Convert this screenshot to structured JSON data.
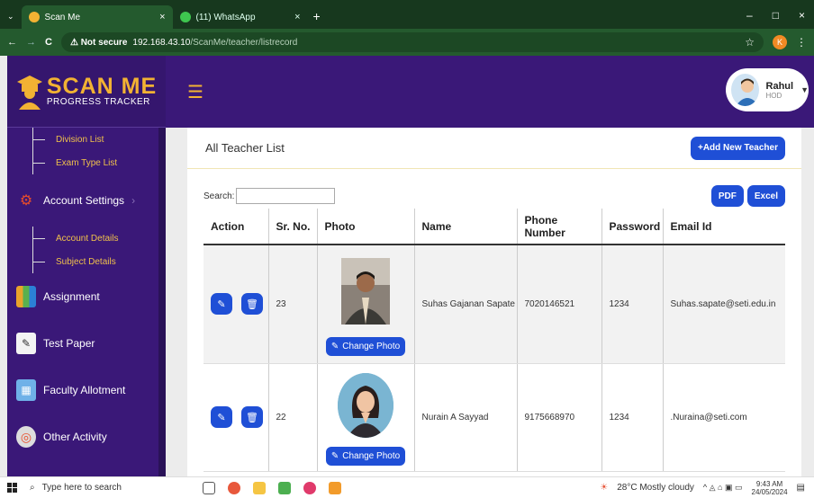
{
  "browser": {
    "tabs": [
      {
        "title": "Scan Me",
        "close": "×"
      },
      {
        "title": "(11) WhatsApp",
        "close": "×"
      }
    ],
    "new_tab": "+",
    "window_controls": {
      "minimize": "–",
      "maximize": "□",
      "close": "×"
    },
    "nav": {
      "back": "←",
      "forward": "→",
      "reload": "C"
    },
    "security": "⚠ Not secure",
    "url_host": "192.168.43.10",
    "url_path": "/ScanMe/teacher/listrecord",
    "star": "☆",
    "profile_initial": "K"
  },
  "logo": {
    "title": "SCAN ME",
    "subtitle": "PROGRESS TRACKER"
  },
  "sidebar": {
    "sub_top": [
      {
        "label": "Division List"
      },
      {
        "label": "Exam Type List"
      }
    ],
    "account": {
      "label": "Account Settings",
      "arrow": "›"
    },
    "sub_account": [
      {
        "label": "Account Details"
      },
      {
        "label": "Subject Details"
      }
    ],
    "items": [
      {
        "label": "Assignment"
      },
      {
        "label": "Test Paper"
      },
      {
        "label": "Faculty Allotment"
      },
      {
        "label": "Other Activity"
      }
    ]
  },
  "header": {
    "menu_icon": "☰",
    "user_name": "Rahul",
    "user_role": "HOD",
    "caret": "▼"
  },
  "page": {
    "title": "All Teacher List",
    "add_button": "+Add New Teacher",
    "search_label": "Search:",
    "search_value": "",
    "pdf_button": "PDF",
    "excel_button": "Excel",
    "change_photo": "Change Photo"
  },
  "table": {
    "columns": [
      "Action",
      "Sr. No.",
      "Photo",
      "Name",
      "Phone Number",
      "Password",
      "Email Id"
    ],
    "rows": [
      {
        "sr": "23",
        "name": "Suhas Gajanan Sapate",
        "phone": "7020146521",
        "password": "1234",
        "email": "Suhas.sapate@seti.edu.in"
      },
      {
        "sr": "22",
        "name": "Nurain A Sayyad",
        "phone": "9175668970",
        "password": "1234",
        "email": ".Nuraina@seti.com"
      }
    ]
  },
  "taskbar": {
    "search_placeholder": "Type here to search",
    "weather": "28°C  Mostly cloudy",
    "time": "9:43 AM",
    "date": "24/05/2024"
  },
  "colors": {
    "sidebar": "#3a1878",
    "accent": "#f2b233",
    "button": "#1f4fd6",
    "browser": "#245a2e"
  }
}
